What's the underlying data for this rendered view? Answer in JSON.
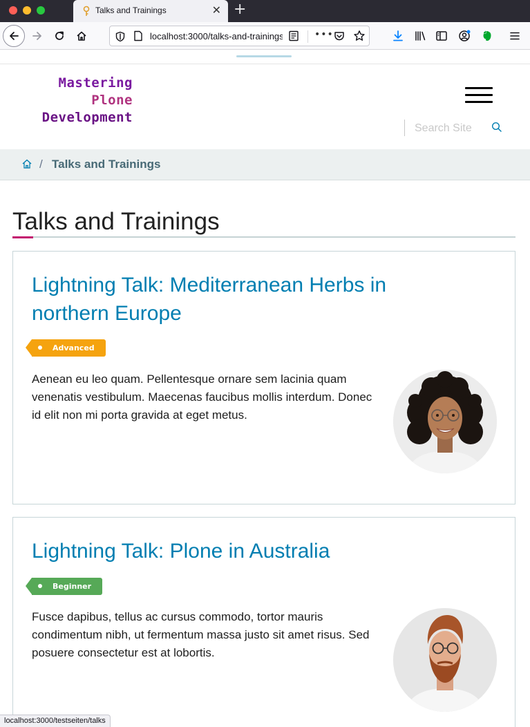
{
  "browser": {
    "tab_title": "Talks and Trainings",
    "url": "localhost:3000/talks-and-trainings",
    "status_url": "localhost:3000/testseiten/talks"
  },
  "site": {
    "logo_lines": [
      "Mastering",
      "Plone",
      "Development"
    ],
    "search_placeholder": "Search Site"
  },
  "breadcrumbs": {
    "items": [
      "Talks and Trainings"
    ]
  },
  "page": {
    "title": "Talks and Trainings"
  },
  "talks": [
    {
      "title": "Lightning Talk: Mediterranean Herbs in northern Europe",
      "level": "Advanced",
      "level_color": "#f5a30f",
      "description": "Aenean eu leo quam. Pellentesque ornare sem lacinia quam venenatis vestibulum. Maecenas faucibus mollis interdum. Donec id elit non mi porta gravida at eget metus."
    },
    {
      "title": "Lightning Talk: Plone in Australia",
      "level": "Beginner",
      "level_color": "#56a957",
      "description": "Fusce dapibus, tellus ac cursus commodo, tortor mauris condimentum nibh, ut fermentum massa justo sit amet risus. Sed posuere consectetur est at lobortis."
    }
  ],
  "colors": {
    "link": "#007eb1",
    "accent": "#c3116e",
    "breadcrumb_bg": "#ecf0f0"
  }
}
